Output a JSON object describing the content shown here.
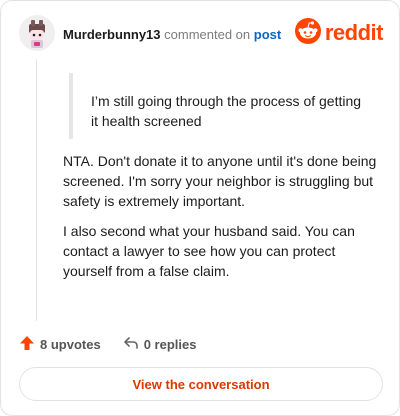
{
  "header": {
    "username": "Murderbunny13",
    "action_text": "commented on",
    "post_link": "post",
    "brand": "reddit"
  },
  "quote": {
    "text": "I’m still going through the process of getting it health screened"
  },
  "comment": {
    "paragraphs": [
      "NTA. Don't donate it to anyone until it's done being screened. I'm sorry your neighbor is struggling but safety is extremely important.",
      "I also second what your husband said. You can contact a lawyer to see how you can protect yourself from a false claim."
    ]
  },
  "footer": {
    "upvotes": "8 upvotes",
    "replies": "0 replies"
  },
  "cta": {
    "label": "View the conversation"
  },
  "colors": {
    "accent": "#ff4500",
    "link": "#0a66c2",
    "cta_text": "#d93a00"
  },
  "icons": [
    "avatar",
    "reddit-logo-icon",
    "upvote-arrow-icon",
    "reply-icon"
  ]
}
